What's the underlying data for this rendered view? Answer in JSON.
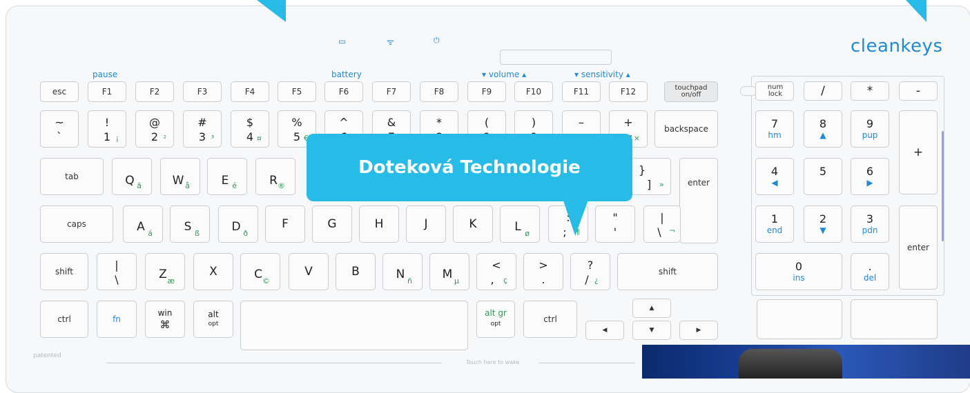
{
  "brand": "cleankeys",
  "callout": "Doteková Technologie",
  "labels": {
    "pause": "pause",
    "battery": "battery",
    "volume": "▾ volume ▴",
    "sensitivity": "▾ sensitivity ▴",
    "patented": "patented",
    "wake": "Touch here to wake"
  },
  "indicators": {
    "battery": "▭",
    "wifi": "ᯤ",
    "power": "⏻"
  },
  "fn_row": [
    "esc",
    "F1",
    "F2",
    "F3",
    "F4",
    "F5",
    "F6",
    "F7",
    "F8",
    "F9",
    "F10",
    "F11",
    "F12"
  ],
  "touchpad": {
    "line1": "touchpad",
    "line2": "on/off"
  },
  "num_row": [
    {
      "t": "~",
      "b": "`"
    },
    {
      "t": "!",
      "b": "1",
      "g": "¡"
    },
    {
      "t": "@",
      "b": "2",
      "g": "²"
    },
    {
      "t": "#",
      "b": "3",
      "g": "³"
    },
    {
      "t": "$",
      "b": "4",
      "g": "¤"
    },
    {
      "t": "%",
      "b": "5",
      "g": "€"
    },
    {
      "t": "^",
      "b": "6"
    },
    {
      "t": "&",
      "b": "7"
    },
    {
      "t": "*",
      "b": "8"
    },
    {
      "t": "(",
      "b": "9"
    },
    {
      "t": ")",
      "b": "0"
    },
    {
      "t": "–",
      "b": "-"
    },
    {
      "t": "+",
      "b": "=",
      "g": "×"
    }
  ],
  "backspace": "backspace",
  "tab": "tab",
  "q_row": [
    {
      "m": "Q",
      "g": "ä"
    },
    {
      "m": "W",
      "g": "å"
    },
    {
      "m": "E",
      "g": "é"
    },
    {
      "m": "R",
      "g": "®"
    }
  ],
  "bracket": {
    "t": "}",
    "b": "]",
    "g": "»"
  },
  "enter": "enter",
  "caps": "caps",
  "a_row": [
    {
      "m": "A",
      "g": "á"
    },
    {
      "m": "S",
      "g": "ß"
    },
    {
      "m": "D",
      "g": "ð"
    },
    {
      "m": "F"
    },
    {
      "m": "G"
    },
    {
      "m": "H"
    },
    {
      "m": "J"
    },
    {
      "m": "K"
    },
    {
      "m": "L",
      "g": "ø"
    }
  ],
  "semi": {
    "t": ":",
    "b": ";",
    "g": "¶"
  },
  "quote": {
    "t": "\"",
    "b": "'"
  },
  "pipe": {
    "t": "|",
    "b": "\\",
    "g": "¬"
  },
  "shift_l": "shift",
  "shift_r": "shift",
  "z_row_first": {
    "t": "|",
    "b": "\\"
  },
  "z_row": [
    {
      "m": "Z",
      "g": "æ"
    },
    {
      "m": "X"
    },
    {
      "m": "C",
      "g": "©"
    },
    {
      "m": "V"
    },
    {
      "m": "B"
    },
    {
      "m": "N",
      "g": "ñ"
    },
    {
      "m": "M",
      "g": "µ"
    }
  ],
  "comma": {
    "t": "<",
    "b": ",",
    "g": "ç"
  },
  "period": {
    "t": ">",
    "b": "."
  },
  "slash": {
    "t": "?",
    "b": "/",
    "g": "¿"
  },
  "bottom": {
    "ctrl": "ctrl",
    "fn": "fn",
    "win": "win",
    "cmd": "⌘",
    "alt": "alt",
    "opt": "opt",
    "altgr": "alt gr",
    "ctrl_r": "ctrl"
  },
  "arrows": {
    "up": "▲",
    "left": "◀",
    "down": "▼",
    "right": "▶"
  },
  "numpad": {
    "numlock": "num lock",
    "div": "/",
    "mul": "*",
    "minus": "-",
    "plus": "+",
    "enter": "enter",
    "k7": {
      "m": "7",
      "s": "hm"
    },
    "k8": {
      "m": "8",
      "s": "▲"
    },
    "k9": {
      "m": "9",
      "s": "pup"
    },
    "k4": {
      "m": "4",
      "s": "◀"
    },
    "k5": {
      "m": "5",
      "s": ""
    },
    "k6": {
      "m": "6",
      "s": "▶"
    },
    "k1": {
      "m": "1",
      "s": "end"
    },
    "k2": {
      "m": "2",
      "s": "▼"
    },
    "k3": {
      "m": "3",
      "s": "pdn"
    },
    "k0": {
      "m": "0",
      "s": "ins"
    },
    "kdot": {
      "m": ".",
      "s": "del"
    }
  },
  "colors": {
    "accent": "#1f8ad6",
    "callout": "#27bce8",
    "green": "#2e9a53"
  }
}
